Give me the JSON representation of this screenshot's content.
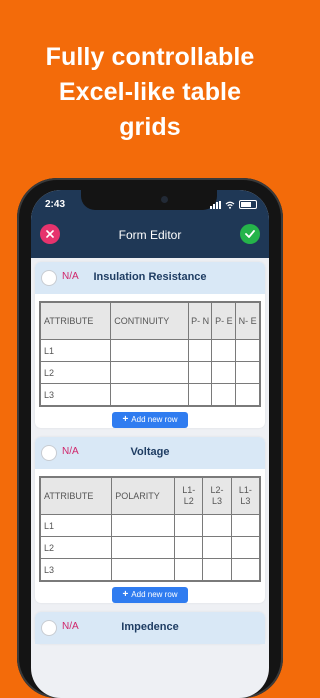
{
  "headline": [
    "Fully controllable",
    "Excel-like table",
    "grids"
  ],
  "status": {
    "time": "2:43"
  },
  "app": {
    "title": "Form Editor"
  },
  "sections": [
    {
      "na_label": "N/A",
      "title": "Insulation Resistance",
      "columns": [
        "ATTRIBUTE",
        "CONTINUITY",
        "P- N",
        "P- E",
        "N- E"
      ],
      "rows": [
        "L1",
        "L2",
        "L3"
      ],
      "add_label": "Add new row"
    },
    {
      "na_label": "N/A",
      "title": "Voltage",
      "columns": [
        "ATTRIBUTE",
        "POLARITY",
        "L1- L2",
        "L2- L3",
        "L1- L3"
      ],
      "rows": [
        "L1",
        "L2",
        "L3"
      ],
      "add_label": "Add new row"
    },
    {
      "na_label": "N/A",
      "title": "Impedence"
    }
  ],
  "colors": {
    "background": "#f36b0a",
    "appbar": "#1f3856",
    "close": "#e6336d",
    "confirm": "#25b44a",
    "add_button": "#2f7cf0",
    "section_header": "#d9e8f6"
  }
}
